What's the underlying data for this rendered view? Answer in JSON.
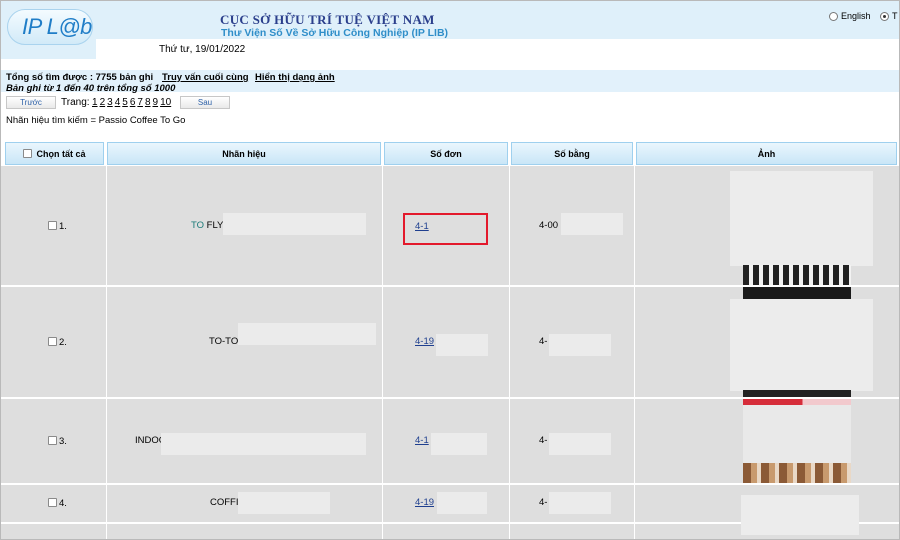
{
  "header": {
    "logo": "IP L@b",
    "org_title": "CỤC SỞ HỮU TRÍ TUỆ VIỆT NAM",
    "lib_title": "Thư Viện Số Về Sở Hữu Công Nghiệp (IP LIB)",
    "date": "Thứ tư, 19/01/2022",
    "lang_english": "English",
    "lang_other": "T"
  },
  "summary": {
    "total": "Tổng số tìm được : 7755 bản ghi",
    "link_consult": "Truy vấn cuối cùng",
    "link_image": "Hiển thị dạng ảnh",
    "range": "Bản ghi từ 1 đến 40 trên tổng số 1000"
  },
  "pager": {
    "prev": "Trước",
    "label": "Trang:",
    "pages": [
      "1",
      "2",
      "3",
      "4",
      "5",
      "6",
      "7",
      "8",
      "9",
      "10"
    ],
    "next": "Sau"
  },
  "query": "Nhãn hiệu tìm kiếm = Passio Coffee To Go",
  "table": {
    "headers": {
      "select_all": "Chọn tất cả",
      "mark": "Nhãn hiệu",
      "application": "Số đơn",
      "registration": "Số bằng",
      "image": "Ảnh"
    },
    "rows": [
      {
        "index": "1.",
        "mark_highlight": "TO",
        "mark_rest": " FLY",
        "application": "4-1",
        "registration": "4-00"
      },
      {
        "index": "2.",
        "mark_highlight": "",
        "mark_rest": "TO-TO",
        "application": "4-19",
        "registration": "4-"
      },
      {
        "index": "3.",
        "mark_highlight": "",
        "mark_rest": "INDOO",
        "application": "4-1",
        "registration": "4-"
      },
      {
        "index": "4.",
        "mark_highlight": "",
        "mark_rest": "COFFI",
        "application": "4-19",
        "registration": "4-"
      }
    ]
  },
  "colors": {
    "header_bg": "#dff0fa",
    "title_navy": "#2b3f8c",
    "subtitle_blue": "#2f8ec9",
    "row_bg": "#dedede",
    "highlight_box": "#e3192c"
  }
}
